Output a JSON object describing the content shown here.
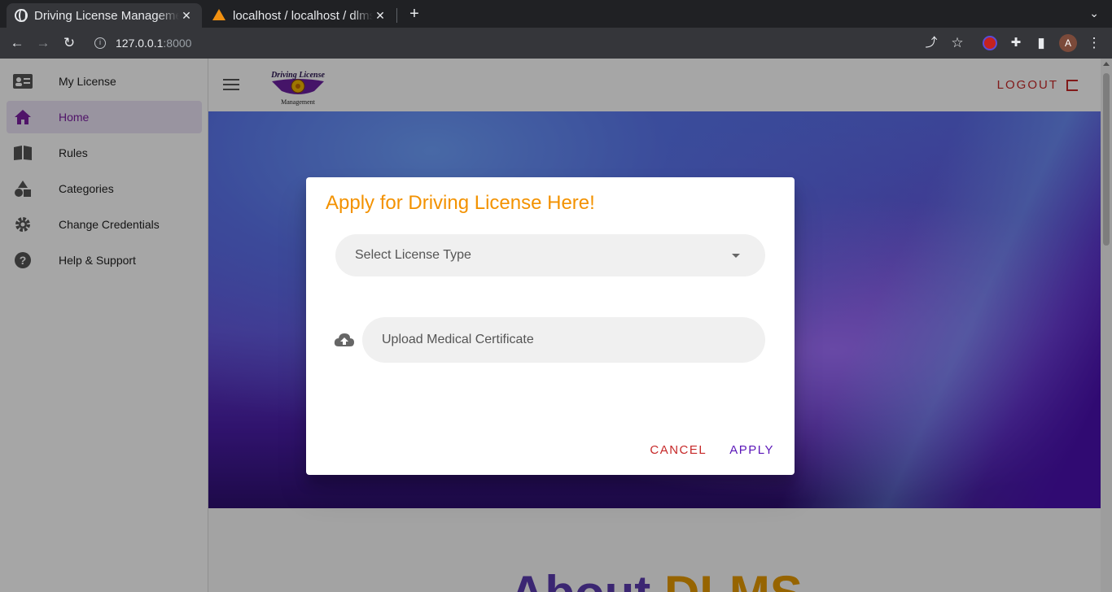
{
  "browser": {
    "tabs": [
      {
        "title": "Driving License Management",
        "close": "✕",
        "active": true
      },
      {
        "title": "localhost / localhost / dlms",
        "close": "✕",
        "active": false
      }
    ],
    "new_tab": "+",
    "url_host": "127.0.0.1",
    "url_port": ":8000",
    "profile_initial": "A"
  },
  "sidebar": {
    "items": [
      {
        "label": "My License",
        "icon": "id-card-icon"
      },
      {
        "label": "Home",
        "icon": "home-icon",
        "active": true
      },
      {
        "label": "Rules",
        "icon": "book-icon"
      },
      {
        "label": "Categories",
        "icon": "shapes-icon"
      },
      {
        "label": "Change Credentials",
        "icon": "gear-icon"
      },
      {
        "label": "Help & Support",
        "icon": "help-icon"
      }
    ]
  },
  "header": {
    "logo_top": "Driving License",
    "logo_bottom": "Management",
    "logout_label": "LOGOUT"
  },
  "about": {
    "part1": "About",
    "part2": "DLMS"
  },
  "dialog": {
    "title": "Apply for Driving License Here!",
    "license_type_placeholder": "Select License Type",
    "upload_placeholder": "Upload Medical Certificate",
    "cancel_label": "CANCEL",
    "apply_label": "APPLY"
  },
  "colors": {
    "accent": "#7b1fa2",
    "title_orange": "#f39200",
    "logout_red": "#c62828",
    "apply_purple": "#5b16b8"
  }
}
